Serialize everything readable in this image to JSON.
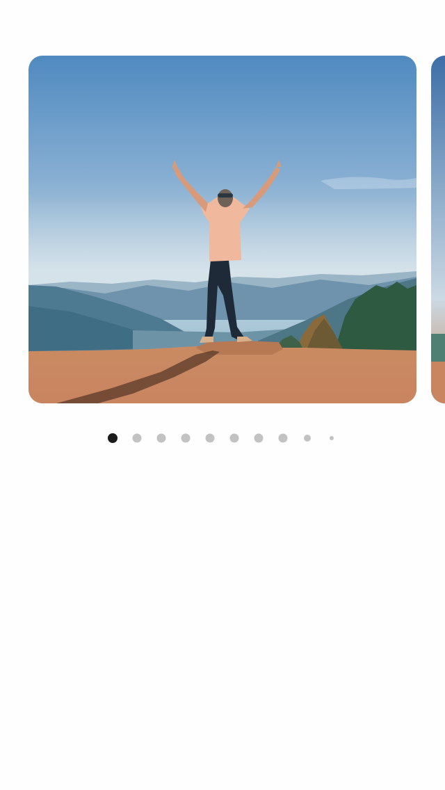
{
  "carousel": {
    "slides": [
      {
        "name": "hiker-on-mountain-photo"
      },
      {
        "name": "next-photo"
      }
    ],
    "active_index": 0,
    "dot_count": 10
  },
  "colors": {
    "background": "#fefefe",
    "dot_active": "#1b1b1b",
    "dot_inactive": "#c2c2c2"
  }
}
